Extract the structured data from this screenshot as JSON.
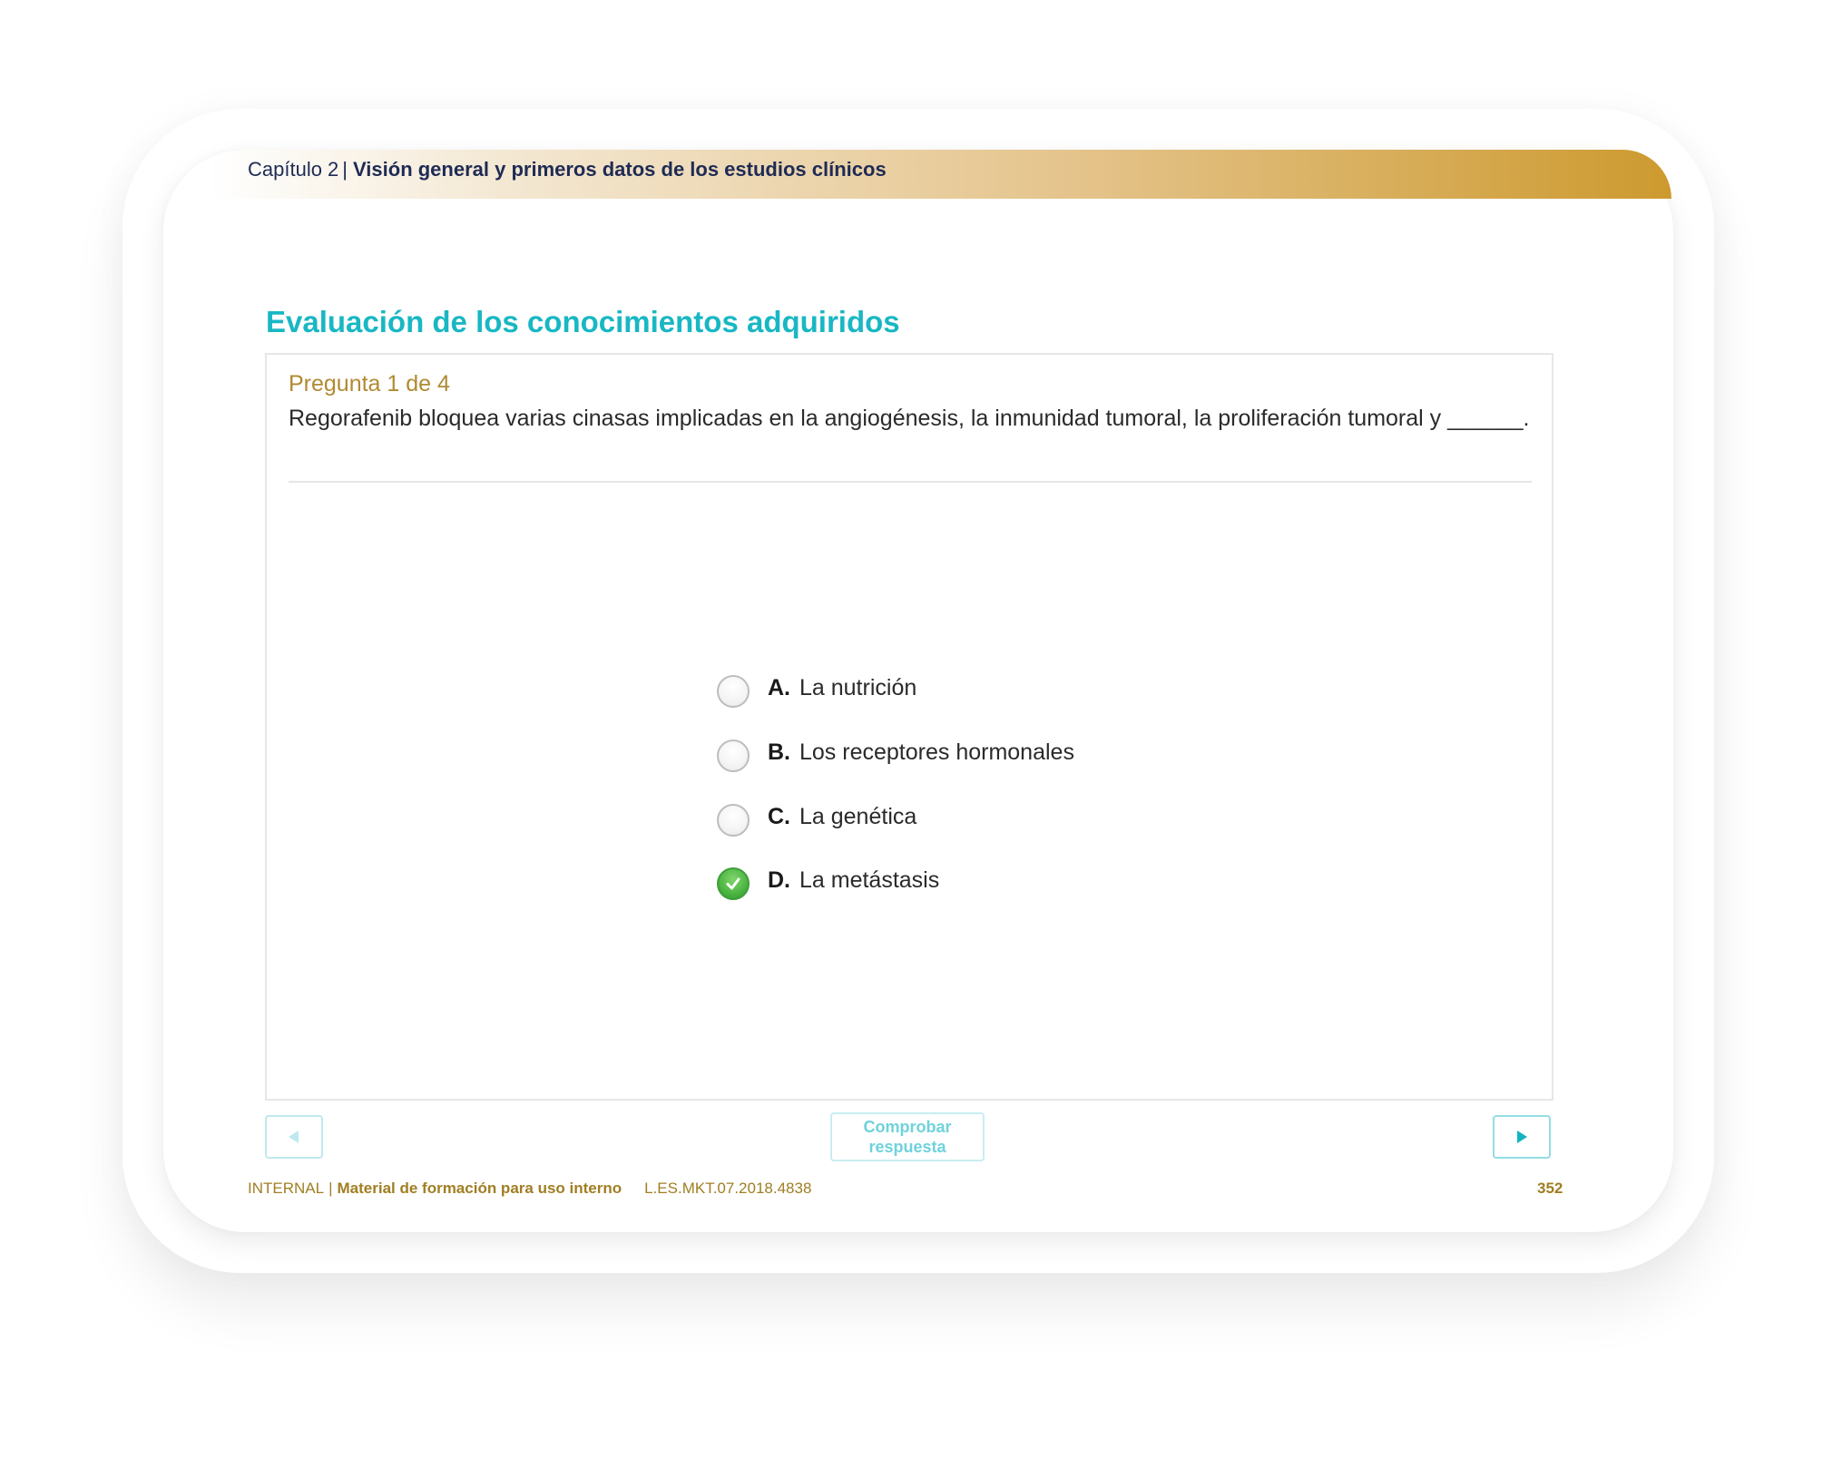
{
  "header": {
    "chapter": "Capítulo 2",
    "separator": "|",
    "subject": "Visión general y primeros datos de los estudios clínicos"
  },
  "section_title": "Evaluación de los conocimientos adquiridos",
  "question": {
    "number": "Pregunta 1 de 4",
    "text": "Regorafenib bloquea varias cinasas implicadas en la angiogénesis, la inmunidad tumoral, la proliferación tumoral y ______."
  },
  "options": [
    {
      "letter": "A.",
      "text": "La nutrición",
      "selected": false
    },
    {
      "letter": "B.",
      "text": "Los receptores hormonales",
      "selected": false
    },
    {
      "letter": "C.",
      "text": "La genética",
      "selected": false
    },
    {
      "letter": "D.",
      "text": "La metástasis",
      "selected": true
    }
  ],
  "buttons": {
    "check_answer": "Comprobar respuesta",
    "prev_icon": "triangle-left-icon",
    "next_icon": "triangle-right-icon"
  },
  "footer": {
    "internal": "INTERNAL",
    "separator": "|",
    "material": "Material de formación para uso interno",
    "code": "L.ES.MKT.07.2018.4838",
    "page_number": "352"
  },
  "colors": {
    "accent_teal": "#19b7c4",
    "gold": "#b08a32",
    "header_navy": "#1f2b55",
    "selected_green": "#4cb542"
  }
}
